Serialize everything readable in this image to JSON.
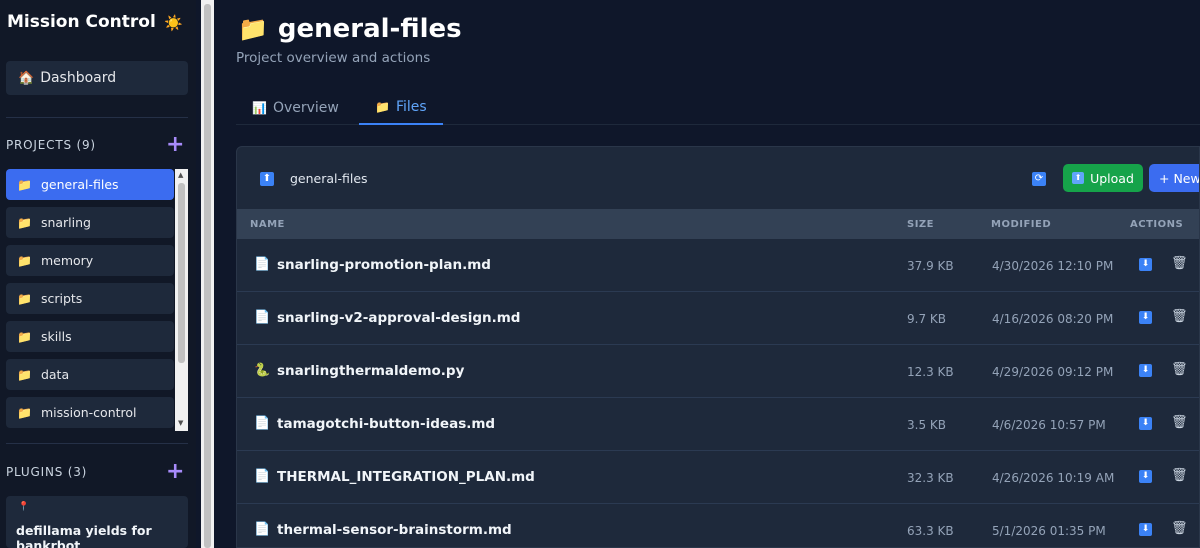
{
  "sidebar": {
    "brand": "Mission Control",
    "brand_icon": "☀️",
    "dashboard": {
      "icon": "🏠",
      "label": "Dashboard"
    },
    "projects_title": "PROJECTS (9)",
    "plugins_title": "PLUGINS (3)",
    "projects": [
      {
        "label": "general-files",
        "active": true
      },
      {
        "label": "snarling"
      },
      {
        "label": "memory"
      },
      {
        "label": "scripts"
      },
      {
        "label": "skills"
      },
      {
        "label": "data"
      },
      {
        "label": "mission-control"
      }
    ],
    "plugin": {
      "icon": "📍",
      "label": "defillama yields for bankrbot"
    }
  },
  "main": {
    "title_icon": "📁",
    "title": "general-files",
    "subtitle": "Project overview and actions",
    "tabs": [
      {
        "icon": "📊",
        "label": "Overview"
      },
      {
        "icon": "📁",
        "label": "Files",
        "active": true
      }
    ],
    "panel": {
      "path": "general-files",
      "upload_label": "Upload",
      "new_label": "+ New",
      "columns": {
        "name": "NAME",
        "size": "SIZE",
        "modified": "MODIFIED",
        "actions": "ACTIONS"
      },
      "files": [
        {
          "icon": "📄",
          "name": "snarling-promotion-plan.md",
          "size": "37.9 KB",
          "modified": "4/30/2026 12:10 PM"
        },
        {
          "icon": "📄",
          "name": "snarling-v2-approval-design.md",
          "size": "9.7 KB",
          "modified": "4/16/2026 08:20 PM"
        },
        {
          "icon": "🐍",
          "name": "snarlingthermaldemo.py",
          "size": "12.3 KB",
          "modified": "4/29/2026 09:12 PM"
        },
        {
          "icon": "📄",
          "name": "tamagotchi-button-ideas.md",
          "size": "3.5 KB",
          "modified": "4/6/2026 10:57 PM"
        },
        {
          "icon": "📄",
          "name": "THERMAL_INTEGRATION_PLAN.md",
          "size": "32.3 KB",
          "modified": "4/26/2026 10:19 AM"
        },
        {
          "icon": "📄",
          "name": "thermal-sensor-brainstorm.md",
          "size": "63.3 KB",
          "modified": "5/1/2026 01:35 PM"
        }
      ]
    }
  }
}
